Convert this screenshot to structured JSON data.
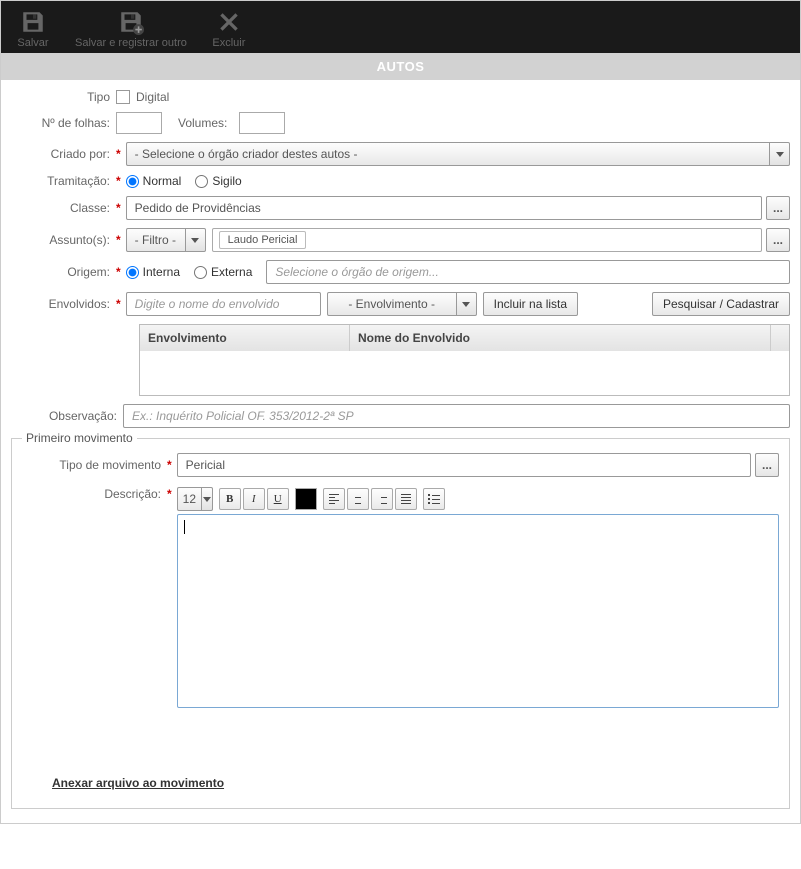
{
  "toolbar": {
    "save": "Salvar",
    "save_new": "Salvar e registrar outro",
    "delete": "Excluir"
  },
  "titlebar": "AUTOS",
  "labels": {
    "tipo": "Tipo",
    "digital": "Digital",
    "n_folhas": "Nº de folhas:",
    "volumes": "Volumes:",
    "criado_por": "Criado por:",
    "tramitacao": "Tramitação:",
    "classe": "Classe:",
    "assuntos": "Assunto(s):",
    "origem": "Origem:",
    "envolvidos": "Envolvidos:",
    "observacao": "Observação:"
  },
  "fields": {
    "criado_por_placeholder": "- Selecione o órgão criador destes autos -",
    "tram_normal": "Normal",
    "tram_sigilo": "Sigilo",
    "classe_value": "Pedido de Providências",
    "assunto_filter": "- Filtro -",
    "assunto_tag": "Laudo Pericial",
    "origem_interna": "Interna",
    "origem_externa": "Externa",
    "origem_placeholder": "Selecione o órgão de origem...",
    "envolvido_placeholder": "Digite o nome do envolvido",
    "envolvimento_select": "- Envolvimento -",
    "incluir_btn": "Incluir na lista",
    "pesquisar_btn": "Pesquisar / Cadastrar",
    "observacao_placeholder": "Ex.: Inquérito Policial OF. 353/2012-2ª SP"
  },
  "table": {
    "col1": "Envolvimento",
    "col2": "Nome do Envolvido"
  },
  "movimento": {
    "fieldset_title": "Primeiro movimento",
    "tipo_label": "Tipo de movimento",
    "tipo_value": "Pericial",
    "descricao_label": "Descrição:",
    "font_size": "12",
    "attach": "Anexar arquivo ao movimento"
  }
}
